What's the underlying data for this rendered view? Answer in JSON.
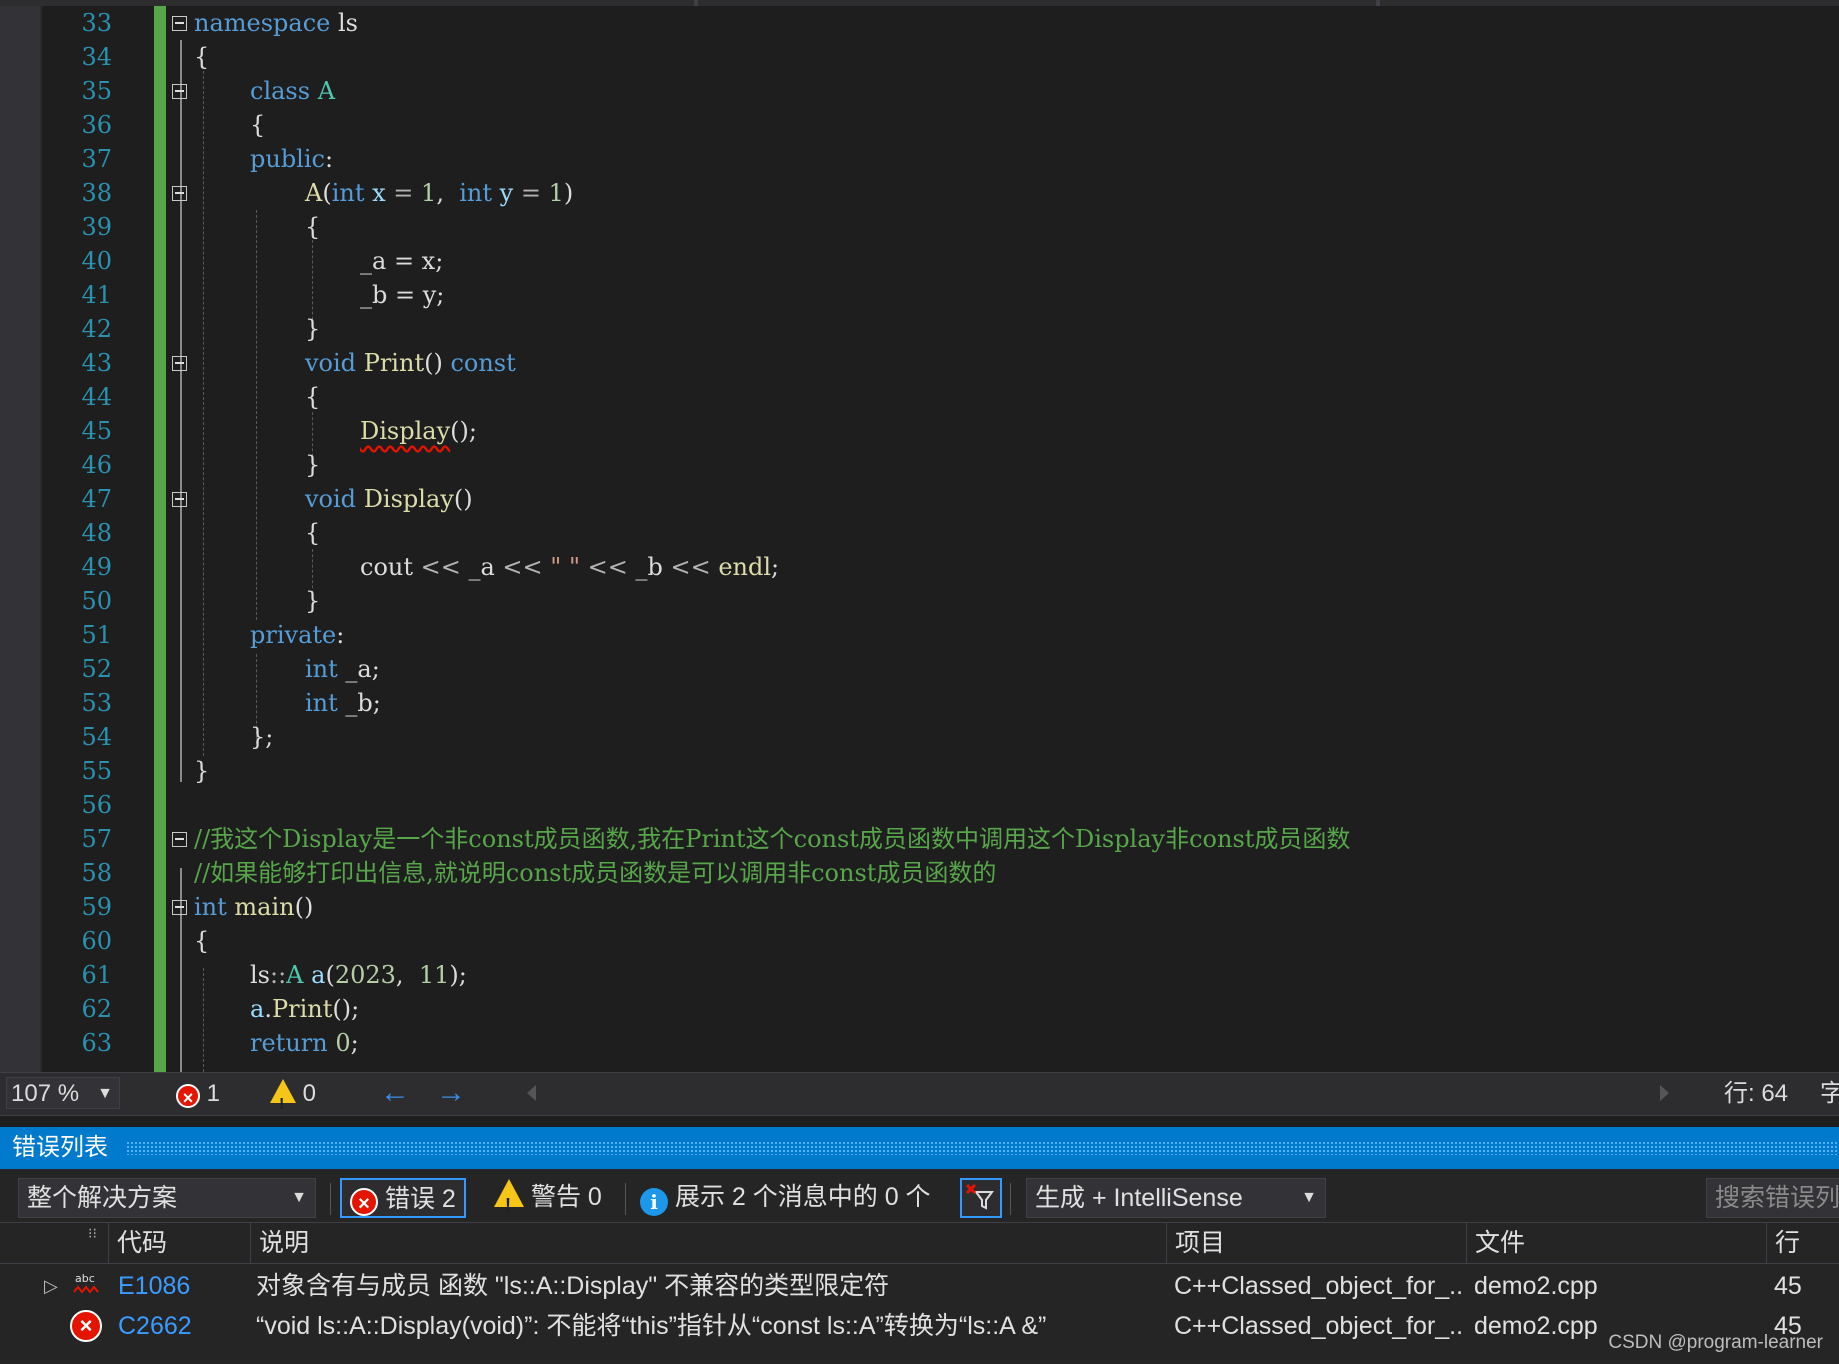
{
  "editor": {
    "lines": [
      {
        "n": "33"
      },
      {
        "n": "34"
      },
      {
        "n": "35"
      },
      {
        "n": "36"
      },
      {
        "n": "37"
      },
      {
        "n": "38"
      },
      {
        "n": "39"
      },
      {
        "n": "40"
      },
      {
        "n": "41"
      },
      {
        "n": "42"
      },
      {
        "n": "43"
      },
      {
        "n": "44"
      },
      {
        "n": "45"
      },
      {
        "n": "46"
      },
      {
        "n": "47"
      },
      {
        "n": "48"
      },
      {
        "n": "49"
      },
      {
        "n": "50"
      },
      {
        "n": "51"
      },
      {
        "n": "52"
      },
      {
        "n": "53"
      },
      {
        "n": "54"
      },
      {
        "n": "55"
      },
      {
        "n": "56"
      },
      {
        "n": "57"
      },
      {
        "n": "58"
      },
      {
        "n": "59"
      },
      {
        "n": "60"
      },
      {
        "n": "61"
      },
      {
        "n": "62"
      },
      {
        "n": "63"
      }
    ],
    "code": {
      "l33": [
        "namespace",
        " ls"
      ],
      "l34": "{",
      "l35": [
        "class",
        " ",
        "A"
      ],
      "l36": "{",
      "l37": [
        "public",
        ":"
      ],
      "l38": [
        "A",
        "(",
        "int",
        " x ",
        "=",
        " ",
        "1",
        ",  ",
        "int",
        " y ",
        "=",
        " ",
        "1",
        ")"
      ],
      "l39": "{",
      "l40": "_a = x;",
      "l41": "_b = y;",
      "l42": "}",
      "l43": [
        "void",
        " ",
        "Print",
        "() ",
        "const"
      ],
      "l44": "{",
      "l45": [
        "Display",
        "();"
      ],
      "l46": "}",
      "l47": [
        "void",
        " ",
        "Display",
        "()"
      ],
      "l48": "{",
      "l49": [
        "cout",
        " << ",
        "_a",
        " << ",
        "\" \"",
        " << ",
        "_b",
        " << ",
        "endl",
        ";"
      ],
      "l50": "}",
      "l51": [
        "private",
        ":"
      ],
      "l52": [
        "int",
        " _a;"
      ],
      "l53": [
        "int",
        " _b;"
      ],
      "l54": "};",
      "l55": "}",
      "l57": "//我这个Display是一个非const成员函数,我在Print这个const成员函数中调用这个Display非const成员函数",
      "l58": "//如果能够打印出信息,就说明const成员函数是可以调用非const成员函数的",
      "l59": [
        "int",
        " ",
        "main",
        "()"
      ],
      "l60": "{",
      "l61": [
        "ls",
        "::",
        "A",
        " ",
        "a",
        "(",
        "2023",
        ",  ",
        "11",
        ");"
      ],
      "l62": [
        "a",
        ".",
        "Print",
        "();"
      ],
      "l63": [
        "return",
        " ",
        "0",
        ";"
      ]
    }
  },
  "status": {
    "zoom": "107 %",
    "errors": "1",
    "warnings": "0",
    "line_label": "行: 64",
    "char_label": "字"
  },
  "errorlist": {
    "title": "错误列表",
    "scope": "整个解决方案",
    "errors_btn": "错误 2",
    "warnings_btn": "警告 0",
    "messages_btn": "展示 2 个消息中的 0 个",
    "source": "生成 + IntelliSense",
    "search_placeholder": "搜索错误列表",
    "columns": [
      "代码",
      "说明",
      "项目",
      "文件",
      "行"
    ],
    "rows": [
      {
        "code": "E1086",
        "desc": "对象含有与成员 函数 \"ls::A::Display\" 不兼容的类型限定符",
        "project": "C++Classed_object_for_...",
        "file": "demo2.cpp",
        "line": "45"
      },
      {
        "code": "C2662",
        "desc": "“void ls::A::Display(void)”: 不能将“this”指针从“const ls::A”转换为“ls::A &”",
        "project": "C++Classed_object_for_...",
        "file": "demo2.cpp",
        "line": "45"
      }
    ]
  },
  "watermark": "CSDN @program-learner",
  "colors": {
    "accent": "#007acc",
    "error": "#e51400",
    "warning": "#f5c518",
    "changebar": "#57a64a",
    "keyword": "#569cd6",
    "type": "#4ec9b0",
    "function": "#dcdcaa",
    "comment": "#57a64a",
    "number": "#b5cea8"
  }
}
